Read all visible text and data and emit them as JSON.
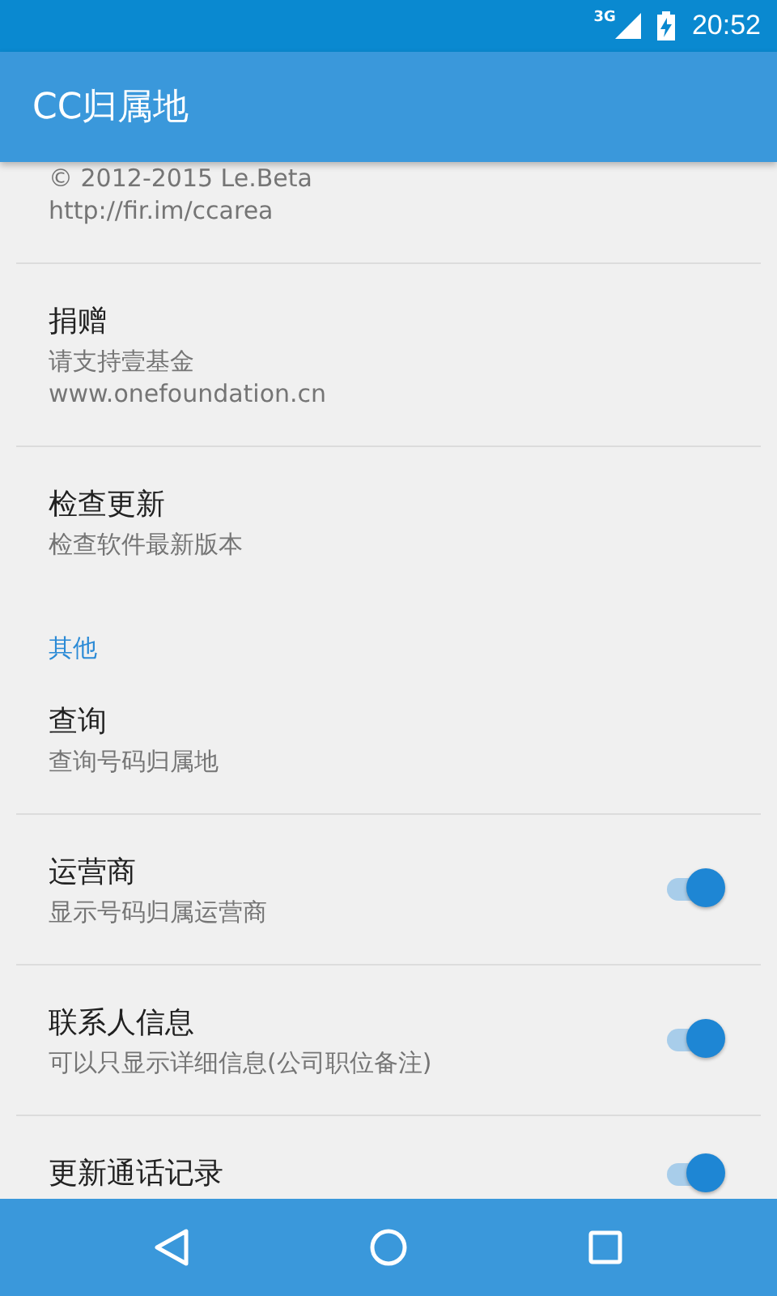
{
  "status_bar": {
    "network": "3G",
    "time": "20:52"
  },
  "app_bar": {
    "title": "CC归属地"
  },
  "items": [
    {
      "kind": "pref",
      "summary": [
        "© 2012-2015 Le.Beta",
        "http://fir.im/ccarea"
      ]
    },
    {
      "kind": "pref",
      "title": "捐赠",
      "summary": [
        "请支持壹基金",
        "www.onefoundation.cn"
      ]
    },
    {
      "kind": "pref",
      "title": "检查更新",
      "summary": [
        "检查软件最新版本"
      ]
    },
    {
      "kind": "category",
      "title": "其他"
    },
    {
      "kind": "pref",
      "title": "查询",
      "summary": [
        "查询号码归属地"
      ]
    },
    {
      "kind": "switch",
      "title": "运营商",
      "summary": [
        "显示号码归属运营商"
      ],
      "on": true
    },
    {
      "kind": "switch",
      "title": "联系人信息",
      "summary": [
        "可以只显示详细信息(公司职位备注)"
      ],
      "on": true
    },
    {
      "kind": "switch",
      "title": "更新通话记录",
      "on": true
    }
  ]
}
